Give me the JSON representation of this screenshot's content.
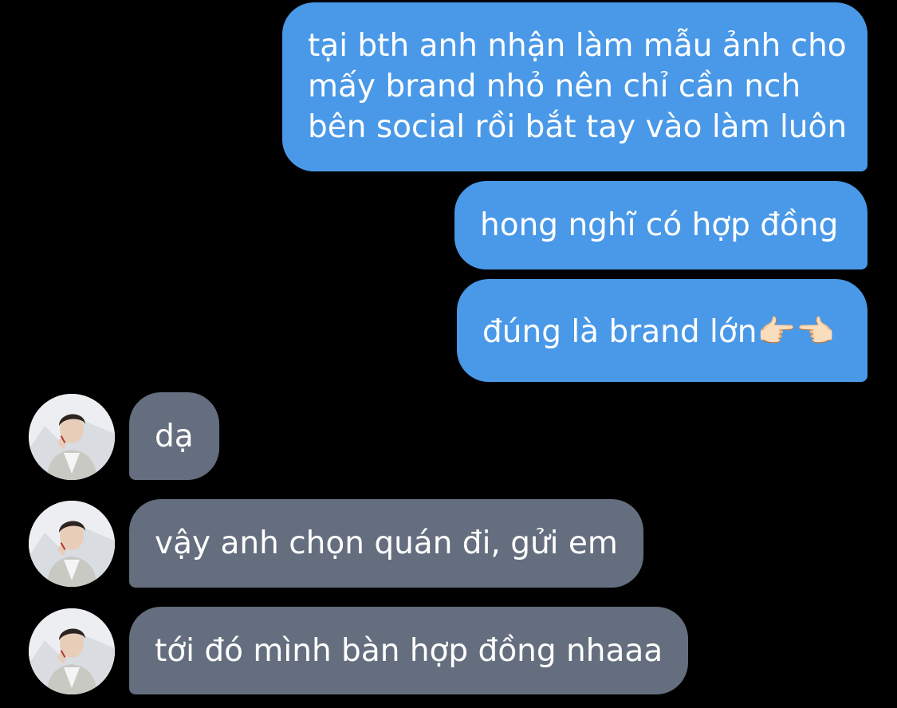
{
  "conversation": {
    "messages": [
      {
        "direction": "sent",
        "text": "tại bth anh nhận làm mẫu ảnh cho\nmấy brand nhỏ nên chỉ cần nch\nbên social rồi bắt tay vào làm luôn"
      },
      {
        "direction": "sent",
        "text": "hong nghĩ có hợp đồng"
      },
      {
        "direction": "sent",
        "text": "đúng là brand lớn👉🏻👈🏻"
      },
      {
        "direction": "received",
        "text": "dạ"
      },
      {
        "direction": "received",
        "text": "vậy anh chọn quán đi, gửi em"
      },
      {
        "direction": "received",
        "text": "tới đó mình bàn hợp đồng nhaaa"
      }
    ]
  },
  "colors": {
    "background": "#000000",
    "sent_bubble": "#4a99e8",
    "received_bubble": "#646e7e",
    "text": "#ffffff"
  },
  "icons": {
    "avatar": "contact-avatar-photo"
  }
}
